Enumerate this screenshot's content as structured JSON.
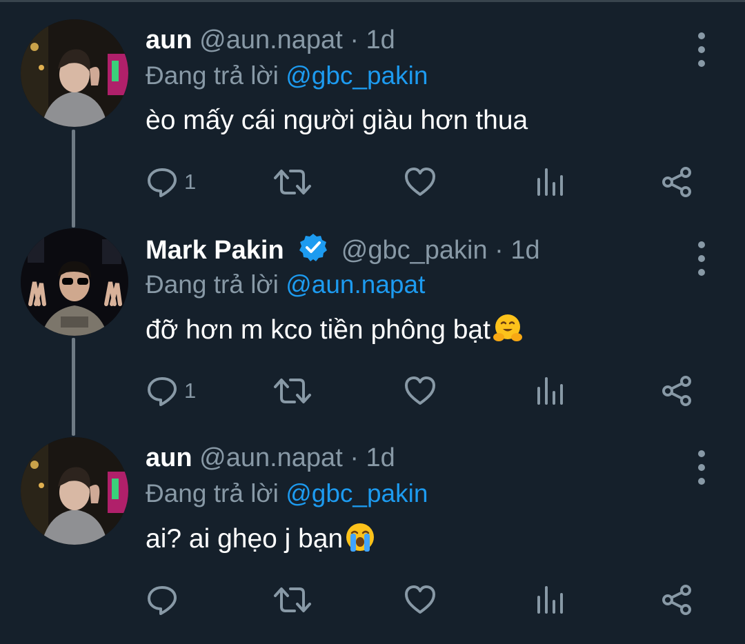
{
  "tweets": [
    {
      "name": "aun",
      "handle": "@aun.napat",
      "dot": "·",
      "time": "1d",
      "reply_prefix": "Đang trả lời",
      "reply_to": "@gbc_pakin",
      "text": "èo mấy cái người giàu hơn thua",
      "reply_count": "1",
      "avatar": "avatar-aun",
      "verified": false,
      "emoji": null
    },
    {
      "name": "Mark Pakin",
      "handle": "@gbc_pakin",
      "dot": "·",
      "time": "1d",
      "reply_prefix": "Đang trả lời",
      "reply_to": "@aun.napat",
      "text": "đỡ hơn m kco tiền phông bạt",
      "reply_count": "1",
      "avatar": "avatar-mark",
      "verified": true,
      "emoji": "hugging-face-emoji"
    },
    {
      "name": "aun",
      "handle": "@aun.napat",
      "dot": "·",
      "time": "1d",
      "reply_prefix": "Đang trả lời",
      "reply_to": "@gbc_pakin",
      "text": "ai? ai ghẹo j bạn",
      "reply_count": "",
      "avatar": "avatar-aun",
      "verified": false,
      "emoji": "loudly-crying-face-emoji"
    }
  ],
  "icons": {
    "reply": "reply-icon",
    "retweet": "retweet-icon",
    "like": "heart-icon",
    "views": "analytics-icon",
    "share": "share-icon",
    "more": "more-vertical-icon"
  },
  "colors": {
    "background": "#15202b",
    "name": "#ffffff",
    "secondary": "#8899a6",
    "mention": "#1d9bf0",
    "thread_line": "#6e7a84"
  }
}
